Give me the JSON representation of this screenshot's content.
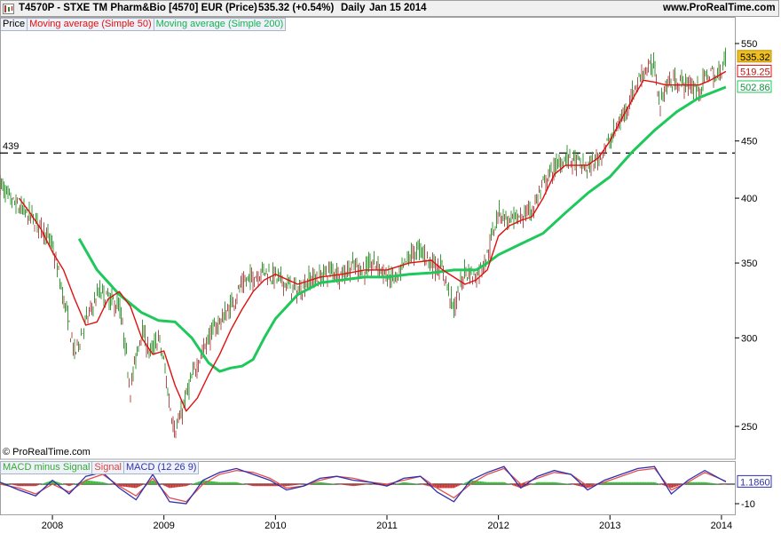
{
  "header": {
    "instrument": "T4570P - STXE TM Pharm&Bio [4570] EUR (Price)",
    "last": "535.32 (+0.54%)",
    "period": "Daily",
    "date": "Jan 15 2014",
    "site": "www.ProRealTime.com"
  },
  "legend": {
    "price": "Price",
    "ma50": "Moving average (Simple 50)",
    "ma200": "Moving average (Simple 200)"
  },
  "macd_legend": {
    "hist": "MACD minus Signal",
    "signal": "Signal",
    "macd": "MACD (12 26 9)"
  },
  "copyright": "© ProRealTime.com",
  "colors": {
    "price_up": "#3a9a3a",
    "price_down": "#b05050",
    "ma50": "#e01010",
    "ma200": "#1ec85a",
    "macd": "#3030b0",
    "signal": "#e05050",
    "hist_pos": "#33bb33",
    "hist_neg": "#cc3333",
    "last_box": "#f0c020"
  },
  "chart_data": {
    "type": "line",
    "x_ticks": [
      "2008",
      "2009",
      "2010",
      "2011",
      "2012",
      "2013",
      "2014"
    ],
    "y_ticks": [
      250,
      300,
      350,
      400,
      450,
      550
    ],
    "ylim": [
      237,
      560
    ],
    "y_scale": "log",
    "horizontal_line": {
      "label": "439",
      "value": 439,
      "style": "dashed"
    },
    "last_values": {
      "price": "535.32",
      "ma50": "519.25",
      "ma200": "502.86"
    },
    "series": [
      {
        "name": "Price",
        "x": [
          2007.53,
          2007.6,
          2007.7,
          2007.8,
          2007.92,
          2008.0,
          2008.1,
          2008.2,
          2008.3,
          2008.42,
          2008.5,
          2008.6,
          2008.7,
          2008.8,
          2008.88,
          2008.95,
          2009.0,
          2009.05,
          2009.1,
          2009.15,
          2009.22,
          2009.3,
          2009.4,
          2009.5,
          2009.6,
          2009.7,
          2009.8,
          2009.9,
          2010.0,
          2010.1,
          2010.2,
          2010.3,
          2010.4,
          2010.5,
          2010.6,
          2010.7,
          2010.8,
          2010.9,
          2011.0,
          2011.1,
          2011.2,
          2011.3,
          2011.4,
          2011.5,
          2011.6,
          2011.65,
          2011.7,
          2011.8,
          2011.9,
          2012.0,
          2012.1,
          2012.2,
          2012.3,
          2012.4,
          2012.5,
          2012.6,
          2012.7,
          2012.8,
          2012.9,
          2013.0,
          2013.1,
          2013.2,
          2013.3,
          2013.4,
          2013.45,
          2013.5,
          2013.6,
          2013.7,
          2013.8,
          2013.9,
          2013.95,
          2014.04
        ],
        "values": [
          413,
          400,
          392,
          385,
          375,
          362,
          325,
          290,
          310,
          330,
          325,
          320,
          270,
          305,
          290,
          300,
          285,
          262,
          248,
          255,
          270,
          285,
          300,
          310,
          320,
          335,
          340,
          345,
          340,
          335,
          330,
          338,
          340,
          345,
          342,
          348,
          345,
          350,
          340,
          338,
          355,
          360,
          350,
          345,
          318,
          330,
          345,
          340,
          355,
          390,
          380,
          385,
          390,
          410,
          425,
          435,
          430,
          425,
          435,
          450,
          470,
          495,
          520,
          525,
          485,
          505,
          510,
          505,
          500,
          520,
          510,
          535.32
        ]
      },
      {
        "name": "Moving average (Simple 50)",
        "x": [
          2007.7,
          2007.8,
          2007.9,
          2008.0,
          2008.1,
          2008.2,
          2008.3,
          2008.4,
          2008.5,
          2008.6,
          2008.7,
          2008.8,
          2008.9,
          2009.0,
          2009.1,
          2009.2,
          2009.3,
          2009.4,
          2009.5,
          2009.6,
          2009.7,
          2009.8,
          2009.9,
          2010.0,
          2010.2,
          2010.4,
          2010.6,
          2010.8,
          2011.0,
          2011.2,
          2011.4,
          2011.5,
          2011.6,
          2011.7,
          2011.8,
          2011.9,
          2012.0,
          2012.1,
          2012.2,
          2012.3,
          2012.4,
          2012.5,
          2012.6,
          2012.7,
          2012.8,
          2012.9,
          2013.0,
          2013.1,
          2013.2,
          2013.3,
          2013.4,
          2013.5,
          2013.6,
          2013.7,
          2013.8,
          2013.9,
          2014.04
        ],
        "values": [
          400,
          388,
          375,
          358,
          345,
          325,
          308,
          310,
          325,
          330,
          320,
          300,
          290,
          292,
          272,
          258,
          265,
          278,
          290,
          305,
          318,
          330,
          338,
          342,
          335,
          340,
          342,
          345,
          345,
          350,
          352,
          345,
          340,
          335,
          338,
          345,
          370,
          378,
          382,
          385,
          400,
          420,
          428,
          428,
          428,
          435,
          450,
          470,
          490,
          510,
          508,
          505,
          505,
          505,
          505,
          510,
          519.25
        ]
      },
      {
        "name": "Moving average (Simple 200)",
        "x": [
          2008.24,
          2008.4,
          2008.6,
          2008.8,
          2008.95,
          2009.1,
          2009.25,
          2009.4,
          2009.5,
          2009.6,
          2009.7,
          2009.8,
          2009.9,
          2010.0,
          2010.2,
          2010.4,
          2010.6,
          2010.8,
          2011.0,
          2011.2,
          2011.4,
          2011.6,
          2011.8,
          2011.9,
          2012.0,
          2012.2,
          2012.4,
          2012.6,
          2012.8,
          2013.0,
          2013.2,
          2013.4,
          2013.6,
          2013.8,
          2014.04
        ],
        "values": [
          368,
          345,
          328,
          316,
          311,
          310,
          300,
          285,
          280,
          282,
          283,
          287,
          300,
          312,
          328,
          336,
          338,
          340,
          340,
          342,
          343,
          345,
          345,
          350,
          356,
          364,
          372,
          388,
          404,
          418,
          440,
          460,
          478,
          492,
          502.86
        ]
      }
    ],
    "macd": {
      "ticks": [
        "-10"
      ],
      "last_values": [
        "1.1860"
      ],
      "x": [
        2007.53,
        2007.7,
        2007.85,
        2008.0,
        2008.15,
        2008.3,
        2008.45,
        2008.6,
        2008.75,
        2008.9,
        2009.05,
        2009.2,
        2009.35,
        2009.5,
        2009.65,
        2009.8,
        2009.95,
        2010.1,
        2010.25,
        2010.4,
        2010.55,
        2010.7,
        2010.85,
        2011.0,
        2011.15,
        2011.3,
        2011.45,
        2011.6,
        2011.75,
        2011.9,
        2012.05,
        2012.2,
        2012.35,
        2012.5,
        2012.65,
        2012.8,
        2012.95,
        2013.1,
        2013.25,
        2013.4,
        2013.55,
        2013.7,
        2013.85,
        2014.04
      ],
      "macd": [
        1,
        -3,
        -6,
        2,
        -5,
        4,
        6,
        -2,
        -8,
        5,
        -9,
        -10,
        2,
        6,
        8,
        5,
        2,
        -3,
        -1,
        3,
        4,
        2,
        1,
        -1,
        3,
        4,
        -4,
        -9,
        2,
        6,
        9,
        -2,
        4,
        7,
        5,
        -3,
        2,
        5,
        8,
        9,
        -5,
        2,
        7,
        1.186
      ],
      "signal": [
        0,
        -2,
        -5,
        0,
        -4,
        2,
        5,
        -1,
        -6,
        3,
        -7,
        -9,
        0,
        5,
        7,
        6,
        3,
        -2,
        -1,
        2,
        4,
        3,
        1,
        0,
        2,
        4,
        -2,
        -7,
        0,
        5,
        8,
        0,
        3,
        6,
        5,
        -1,
        1,
        4,
        7,
        8,
        -3,
        1,
        6,
        1.5
      ]
    }
  }
}
